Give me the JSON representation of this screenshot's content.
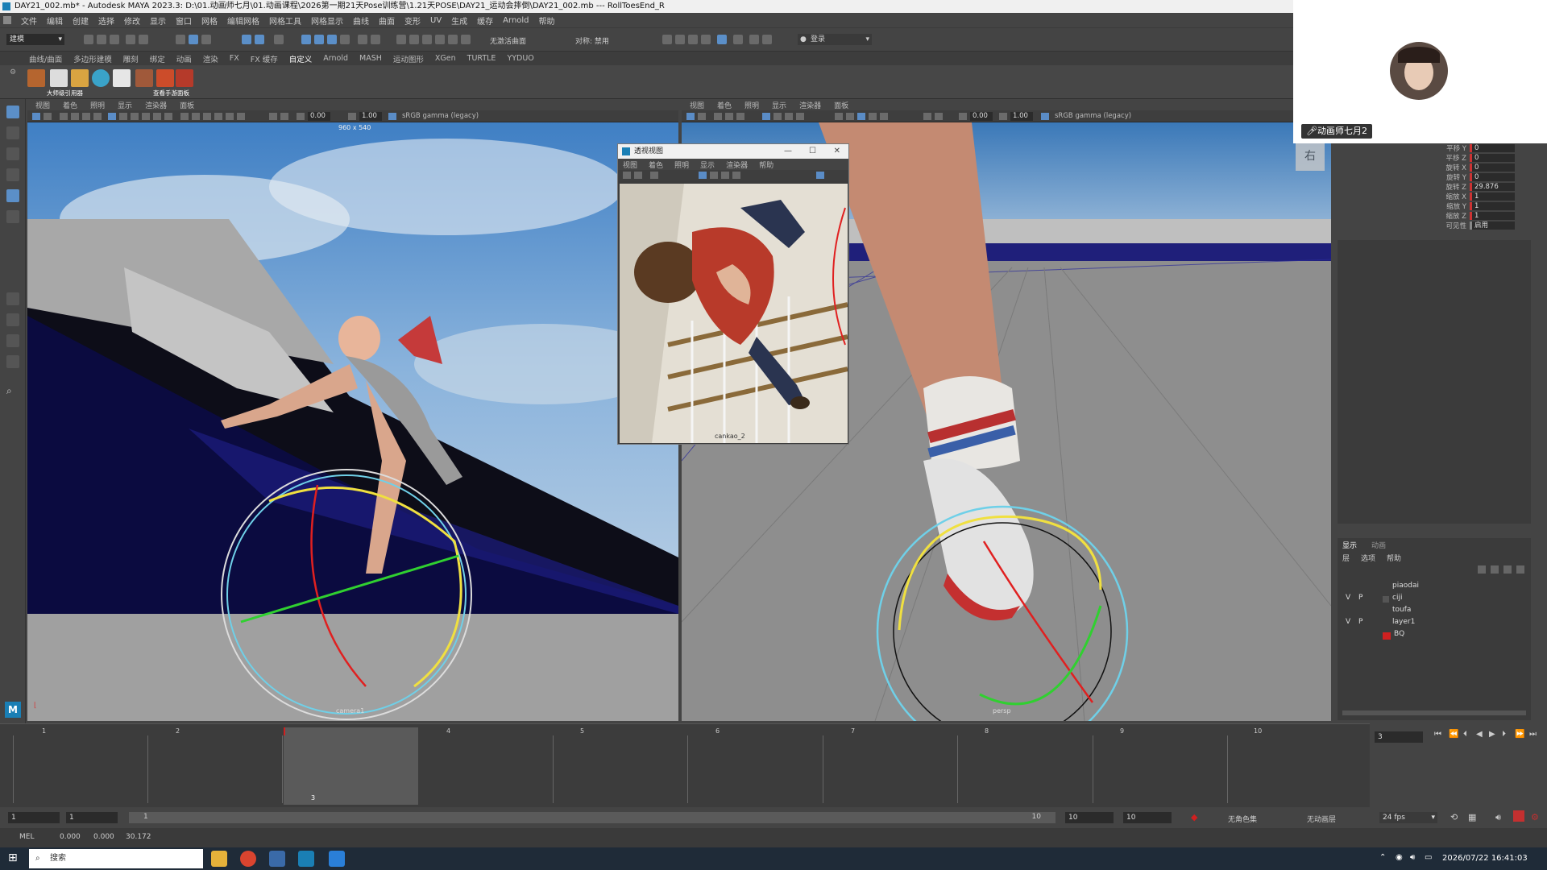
{
  "window": {
    "title": "DAY21_002.mb* - Autodesk MAYA 2023.3: D:\\01.动画师七月\\01.动画课程\\2026第一期21天Pose训练营\\1.21天POSE\\DAY21_运动会摔倒\\DAY21_002.mb   ---   RollToesEnd_R"
  },
  "menubar": [
    "文件",
    "编辑",
    "创建",
    "选择",
    "修改",
    "显示",
    "窗口",
    "网格",
    "编辑网格",
    "网格工具",
    "网格显示",
    "曲线",
    "曲面",
    "变形",
    "UV",
    "生成",
    "缓存",
    "Arnold",
    "帮助"
  ],
  "toolbar": {
    "mode_select": "建模",
    "live_surface": "无激活曲面",
    "symmetry": "对称: 禁用",
    "login": "登录"
  },
  "shelf_tabs": [
    "曲线/曲面",
    "多边形建模",
    "雕刻",
    "绑定",
    "动画",
    "渲染",
    "FX",
    "FX 缓存",
    "自定义",
    "Arnold",
    "MASH",
    "运动图形",
    "XGen",
    "TURTLE",
    "YYDUO"
  ],
  "shelf": {
    "icon_labels": [
      "大师级引用器",
      "查看手游面板"
    ]
  },
  "viewport_menu": [
    "视图",
    "着色",
    "照明",
    "显示",
    "渲染器",
    "面板"
  ],
  "viewport_left": {
    "resolution": "960 x 540",
    "val1": "0.00",
    "val2": "1.00",
    "colorspace": "sRGB gamma (legacy)",
    "camera": "camera1"
  },
  "viewport_right": {
    "val1": "0.00",
    "val2": "1.00",
    "colorspace": "sRGB gamma (legacy)",
    "camera": "persp",
    "view_cube": "右"
  },
  "ref_window": {
    "title": "透视视图",
    "menu": [
      "视图",
      "着色",
      "照明",
      "显示",
      "渲染器",
      "帮助"
    ],
    "camera": "cankao_2"
  },
  "webcam": {
    "name": "动画师七月2"
  },
  "channel_box": [
    {
      "label": "平移 Y",
      "value": "0"
    },
    {
      "label": "平移 Z",
      "value": "0"
    },
    {
      "label": "旋转 X",
      "value": "0"
    },
    {
      "label": "旋转 Y",
      "value": "0"
    },
    {
      "label": "旋转 Z",
      "value": "29.876"
    },
    {
      "label": "缩放 X",
      "value": "1"
    },
    {
      "label": "缩放 Y",
      "value": "1"
    },
    {
      "label": "缩放 Z",
      "value": "1"
    },
    {
      "label": "可见性",
      "value": "启用"
    }
  ],
  "layer_panel": {
    "tabs": [
      "显示",
      "动画"
    ],
    "menu": [
      "层",
      "选项",
      "帮助"
    ],
    "layers": [
      {
        "v": "",
        "p": "",
        "name": "piaodai",
        "color": ""
      },
      {
        "v": "V",
        "p": "P",
        "name": "ciji",
        "color": ""
      },
      {
        "v": "",
        "p": "",
        "name": "toufa",
        "color": ""
      },
      {
        "v": "V",
        "p": "P",
        "name": "layer1",
        "color": ""
      },
      {
        "v": "",
        "p": "",
        "name": "BQ",
        "color": "#d02020"
      }
    ]
  },
  "timeline": {
    "ticks": [
      "1",
      "2",
      "3",
      "4",
      "5",
      "6",
      "7",
      "8",
      "9",
      "10"
    ],
    "current_frame": "3",
    "current_field": "3"
  },
  "range": {
    "start": "1",
    "start2": "1",
    "slider_start": "1",
    "slider_end": "10",
    "end": "10",
    "end2": "10",
    "char_set": "无角色集",
    "anim_layer": "无动画层",
    "fps": "24 fps"
  },
  "cmdline": {
    "label": "MEL",
    "v1": "0.000",
    "v2": "0.000",
    "v3": "30.172"
  },
  "taskbar": {
    "search": "搜索",
    "clock": "2026/07/22 16:41:03"
  },
  "colors": {
    "accent": "#5b8fc8",
    "key_red": "#d02020"
  }
}
